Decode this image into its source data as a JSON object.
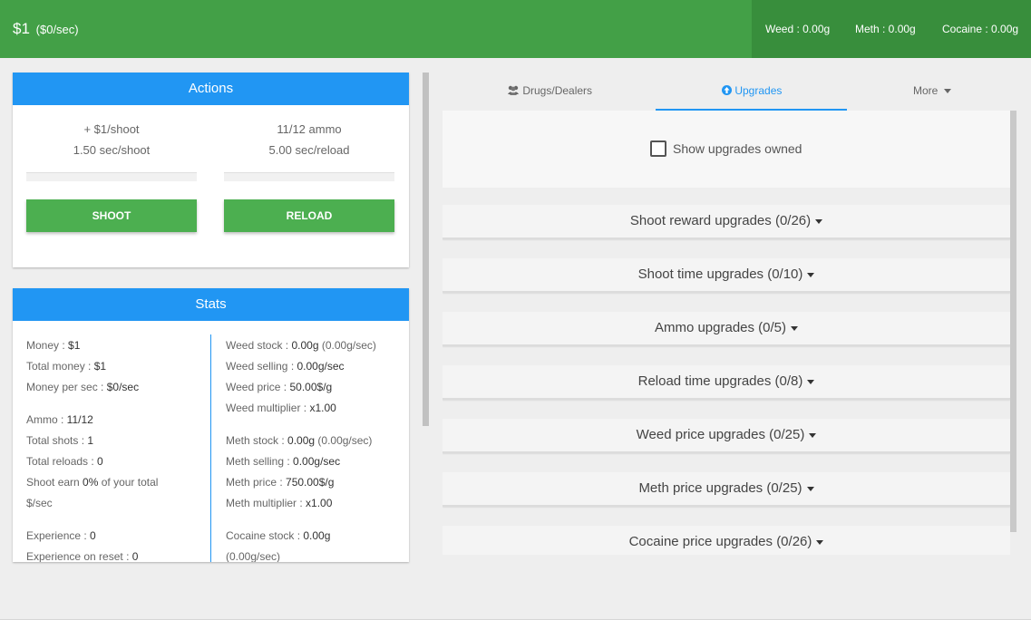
{
  "header": {
    "money": "$1",
    "rate": "($0/sec)",
    "stocks": [
      "Weed : 0.00g",
      "Meth : 0.00g",
      "Cocaine : 0.00g"
    ]
  },
  "actions": {
    "title": "Actions",
    "shoot_reward": "+ $1/shoot",
    "shoot_time": "1.50 sec/shoot",
    "ammo": "11/12 ammo",
    "reload_time": "5.00 sec/reload",
    "shoot_label": "SHOOT",
    "reload_label": "RELOAD"
  },
  "stats": {
    "title": "Stats",
    "left": [
      {
        "label": "Money : ",
        "value": "$1",
        "rest": ""
      },
      {
        "label": "Total money : ",
        "value": "$1",
        "rest": ""
      },
      {
        "label": "Money per sec : ",
        "value": "$0/sec",
        "rest": ""
      },
      {
        "label": "Ammo : ",
        "value": "11/12",
        "rest": ""
      },
      {
        "label": "Total shots : ",
        "value": "1",
        "rest": ""
      },
      {
        "label": "Total reloads : ",
        "value": "0",
        "rest": ""
      },
      {
        "label": "Shoot earn ",
        "value": "0%",
        "rest": " of your total"
      },
      {
        "label": "$/sec",
        "value": "",
        "rest": ""
      },
      {
        "label": "Experience : ",
        "value": "0",
        "rest": ""
      },
      {
        "label": "Experience on reset : ",
        "value": "0",
        "rest": ""
      }
    ],
    "right": [
      {
        "label": "Weed stock : ",
        "value": "0.00g",
        "rest": " (0.00g/sec)"
      },
      {
        "label": "Weed selling : ",
        "value": "0.00g/sec",
        "rest": ""
      },
      {
        "label": "Weed price : ",
        "value": "50.00$/g",
        "rest": ""
      },
      {
        "label": "Weed multiplier : ",
        "value": "x1.00",
        "rest": ""
      },
      {
        "label": "Meth stock : ",
        "value": "0.00g",
        "rest": " (0.00g/sec)"
      },
      {
        "label": "Meth selling : ",
        "value": "0.00g/sec",
        "rest": ""
      },
      {
        "label": "Meth price : ",
        "value": "750.00$/g",
        "rest": ""
      },
      {
        "label": "Meth multiplier : ",
        "value": "x1.00",
        "rest": ""
      },
      {
        "label": "Cocaine stock : ",
        "value": "0.00g",
        "rest": ""
      },
      {
        "label": "(0.00g/sec)",
        "value": "",
        "rest": ""
      }
    ]
  },
  "tabs": [
    {
      "label": "Drugs/Dealers",
      "icon": "users-icon"
    },
    {
      "label": "Upgrades",
      "icon": "arrow-circle-up-icon"
    },
    {
      "label": "More",
      "icon": "caret-down-icon"
    }
  ],
  "upgrades": {
    "show_owned_label": "Show upgrades owned",
    "items": [
      "Shoot reward upgrades (0/26)",
      "Shoot time upgrades (0/10)",
      "Ammo upgrades (0/5)",
      "Reload time upgrades (0/8)",
      "Weed price upgrades (0/25)",
      "Meth price upgrades (0/25)",
      "Cocaine price upgrades (0/26)"
    ]
  },
  "colors": {
    "header_green": "#43a047",
    "header_dark_green": "#388e3c",
    "accent_blue": "#2196f3",
    "button_green": "#4caf50"
  }
}
